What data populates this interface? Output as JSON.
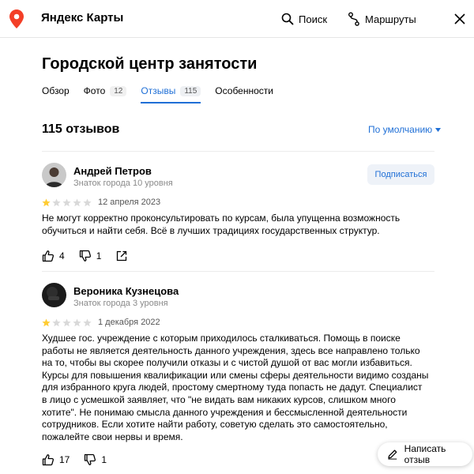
{
  "header": {
    "app_title": "Яндекс Карты",
    "search_label": "Поиск",
    "routes_label": "Маршруты",
    "accent_color": "#1f6fd6",
    "pin_color": "#f33f27"
  },
  "organization": {
    "title": "Городской центр занятости"
  },
  "tabs": [
    {
      "label": "Обзор",
      "count": "",
      "active": false
    },
    {
      "label": "Фото",
      "count": "12",
      "active": false
    },
    {
      "label": "Отзывы",
      "count": "115",
      "active": true
    },
    {
      "label": "Особенности",
      "count": "",
      "active": false
    }
  ],
  "reviews_header": {
    "count_label": "115 отзывов",
    "sort_label": "По умолчанию"
  },
  "reviews": [
    {
      "author": "Андрей Петров",
      "level": "Знаток города 10 уровня",
      "subscribe_label": "Подписаться",
      "rating": 1,
      "date": "12 апреля 2023",
      "text": "Не могут корректно проконсультировать по курсам, была упущенна возможность обучиться и найти себя. Всё в лучших традициях государственных структур.",
      "likes": "4",
      "dislikes": "1"
    },
    {
      "author": "Вероника Кузнецова",
      "level": "Знаток города 3 уровня",
      "rating": 1,
      "date": "1 декабря 2022",
      "text": "Худшее гос. учреждение с которым приходилось сталкиваться. Помощь в поиске работы не является деятельность данного учреждения, здесь все направлено только на то, чтобы вы скорее получили отказы и с чистой душой от вас могли избавиться. Курсы для повышения квалификации или смены сферы деятельности видимо созданы для избранного круга людей, простому смертному туда попасть не дадут. Специалист в лицо с усмешкой заявляет, что \"не видать вам никаких курсов, слишком много хотите\". Не понимаю смысла данного учреждения и бессмысленной деятельности сотрудников. Если хотите найти работу, советую сделать это самостоятельно, пожалейте свои нервы и время.",
      "likes": "17",
      "dislikes": "1"
    }
  ],
  "write_review_label": "Написать отзыв",
  "icons": {
    "logo": "map-pin-icon",
    "search": "search-icon",
    "routes": "routes-icon",
    "close": "close-icon",
    "sort": "chevron-down-icon",
    "like": "thumbs-up-icon",
    "dislike": "thumbs-down-icon",
    "share": "share-icon",
    "write": "pencil-icon",
    "star_filled_color": "#fc3",
    "star_empty_color": "#d9d9d9"
  }
}
